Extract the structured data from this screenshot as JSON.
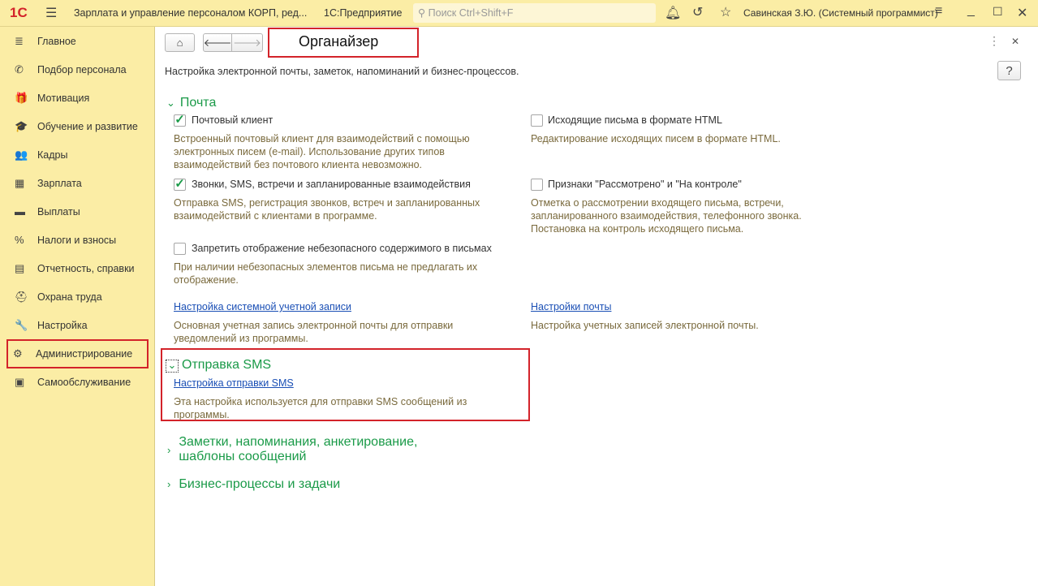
{
  "titlebar": {
    "logo": "1С",
    "app_title": "Зарплата и управление персоналом КОРП, ред...",
    "platform": "1С:Предприятие",
    "search_placeholder": "Поиск Ctrl+Shift+F",
    "user": "Савинская З.Ю. (Системный программист)"
  },
  "sidebar": {
    "items": [
      {
        "label": "Главное",
        "icon": "≣"
      },
      {
        "label": "Подбор персонала",
        "icon": "✆"
      },
      {
        "label": "Мотивация",
        "icon": "🎁"
      },
      {
        "label": "Обучение и развитие",
        "icon": "🎓"
      },
      {
        "label": "Кадры",
        "icon": "👥"
      },
      {
        "label": "Зарплата",
        "icon": "▦"
      },
      {
        "label": "Выплаты",
        "icon": "▬"
      },
      {
        "label": "Налоги и взносы",
        "icon": "%"
      },
      {
        "label": "Отчетность, справки",
        "icon": "▤"
      },
      {
        "label": "Охрана труда",
        "icon": "⛑"
      },
      {
        "label": "Настройка",
        "icon": "🔧"
      },
      {
        "label": "Администрирование",
        "icon": "⚙"
      },
      {
        "label": "Самообслуживание",
        "icon": "▣"
      }
    ]
  },
  "page": {
    "title": "Органайзер",
    "subtitle": "Настройка электронной почты, заметок, напоминаний и бизнес-процессов.",
    "help": "?",
    "mail": {
      "header": "Почта",
      "mail_client": {
        "label": "Почтовый клиент",
        "checked": true,
        "desc": "Встроенный почтовый клиент для взаимодействий с помощью электронных писем (e-mail). Использование других типов взаимодействий без почтового клиента невозможно."
      },
      "html": {
        "label": "Исходящие письма в формате HTML",
        "checked": false,
        "desc": "Редактирование исходящих писем в формате HTML."
      },
      "calls": {
        "label": "Звонки, SMS, встречи и запланированные взаимодействия",
        "checked": true,
        "desc": "Отправка SMS, регистрация звонков, встреч и запланированных взаимодействий с клиентами в программе."
      },
      "flags": {
        "label": "Признаки \"Рассмотрено\" и \"На контроле\"",
        "checked": false,
        "desc": "Отметка о рассмотрении входящего письма, встречи, запланированного взаимодействия, телефонного звонка. Постановка на контроль исходящего письма."
      },
      "unsafe": {
        "label": "Запретить отображение небезопасного содержимого в письмах",
        "checked": false,
        "desc": "При наличии небезопасных элементов письма не предлагать их отображение."
      },
      "sys_account": {
        "link": "Настройка системной учетной записи",
        "desc": "Основная учетная запись электронной почты для отправки уведомлений из программы."
      },
      "mail_settings": {
        "link": "Настройки почты",
        "desc": "Настройка учетных записей электронной почты."
      }
    },
    "sms": {
      "header": "Отправка SMS",
      "link": "Настройка отправки SMS",
      "desc": "Эта настройка используется для отправки SMS сообщений из программы."
    },
    "notes": {
      "header": "Заметки, напоминания, анкетирование, шаблоны сообщений"
    },
    "bp": {
      "header": "Бизнес-процессы и задачи"
    }
  }
}
